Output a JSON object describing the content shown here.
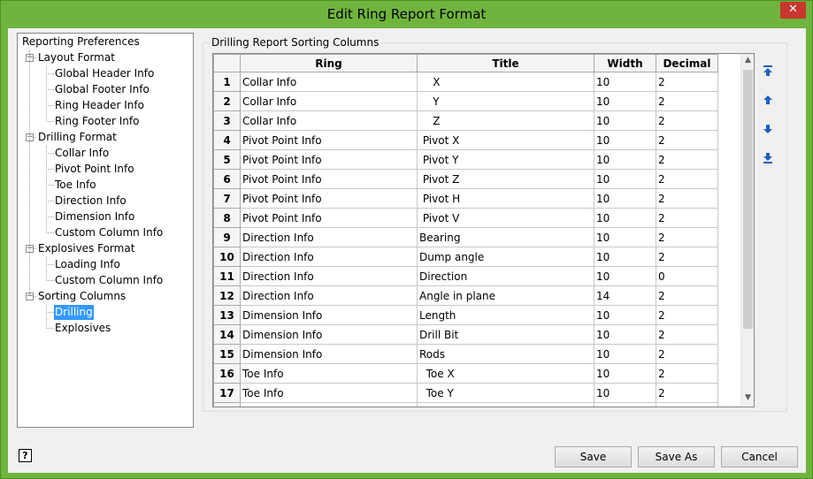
{
  "window": {
    "title": "Edit Ring Report Format",
    "close_label": "✕"
  },
  "tree": {
    "root": "Reporting Preferences",
    "groups": [
      {
        "label": "Layout Format",
        "children": [
          "Global Header Info",
          "Global Footer Info",
          "Ring Header Info",
          "Ring Footer Info"
        ]
      },
      {
        "label": "Drilling Format",
        "children": [
          "Collar Info",
          "Pivot Point Info",
          "Toe Info",
          "Direction Info",
          "Dimension Info",
          "Custom Column Info"
        ]
      },
      {
        "label": "Explosives Format",
        "children": [
          "Loading Info",
          "Custom Column Info"
        ]
      },
      {
        "label": "Sorting Columns",
        "children": [
          "Drilling",
          "Explosives"
        ]
      }
    ],
    "selected": "Drilling"
  },
  "group_title": "Drilling Report Sorting Columns",
  "table": {
    "columns": [
      "Ring",
      "Title",
      "Width",
      "Decimal"
    ],
    "rows": [
      {
        "n": "1",
        "ring": "Collar Info",
        "title": "    X",
        "width": "10",
        "decimal": "2"
      },
      {
        "n": "2",
        "ring": "Collar Info",
        "title": "    Y",
        "width": "10",
        "decimal": "2"
      },
      {
        "n": "3",
        "ring": "Collar Info",
        "title": "    Z",
        "width": "10",
        "decimal": "2"
      },
      {
        "n": "4",
        "ring": "Pivot Point Info",
        "title": " Pivot X",
        "width": "10",
        "decimal": "2"
      },
      {
        "n": "5",
        "ring": "Pivot Point Info",
        "title": " Pivot Y",
        "width": "10",
        "decimal": "2"
      },
      {
        "n": "6",
        "ring": "Pivot Point Info",
        "title": " Pivot Z",
        "width": "10",
        "decimal": "2"
      },
      {
        "n": "7",
        "ring": "Pivot Point Info",
        "title": " Pivot H",
        "width": "10",
        "decimal": "2"
      },
      {
        "n": "8",
        "ring": "Pivot Point Info",
        "title": " Pivot V",
        "width": "10",
        "decimal": "2"
      },
      {
        "n": "9",
        "ring": "Direction Info",
        "title": "Bearing",
        "width": "10",
        "decimal": "2"
      },
      {
        "n": "10",
        "ring": "Direction Info",
        "title": "Dump angle",
        "width": "10",
        "decimal": "2"
      },
      {
        "n": "11",
        "ring": "Direction Info",
        "title": "Direction",
        "width": "10",
        "decimal": "0"
      },
      {
        "n": "12",
        "ring": "Direction Info",
        "title": "Angle in plane",
        "width": "14",
        "decimal": "2"
      },
      {
        "n": "13",
        "ring": "Dimension Info",
        "title": "Length",
        "width": "10",
        "decimal": "2"
      },
      {
        "n": "14",
        "ring": "Dimension Info",
        "title": "Drill Bit",
        "width": "10",
        "decimal": "2"
      },
      {
        "n": "15",
        "ring": "Dimension Info",
        "title": "Rods",
        "width": "10",
        "decimal": "2"
      },
      {
        "n": "16",
        "ring": "Toe Info",
        "title": "  Toe X",
        "width": "10",
        "decimal": "2"
      },
      {
        "n": "17",
        "ring": "Toe Info",
        "title": "  Toe Y",
        "width": "10",
        "decimal": "2"
      }
    ]
  },
  "side_buttons": [
    "move-to-top-icon",
    "move-up-icon",
    "move-down-icon",
    "move-to-bottom-icon"
  ],
  "buttons": {
    "save": "Save",
    "save_as": "Save As",
    "cancel": "Cancel"
  },
  "help_label": "?",
  "colors": {
    "title_bar": "#70b43d",
    "selection": "#3399ff",
    "arrow_blue": "#1f5fbf"
  }
}
